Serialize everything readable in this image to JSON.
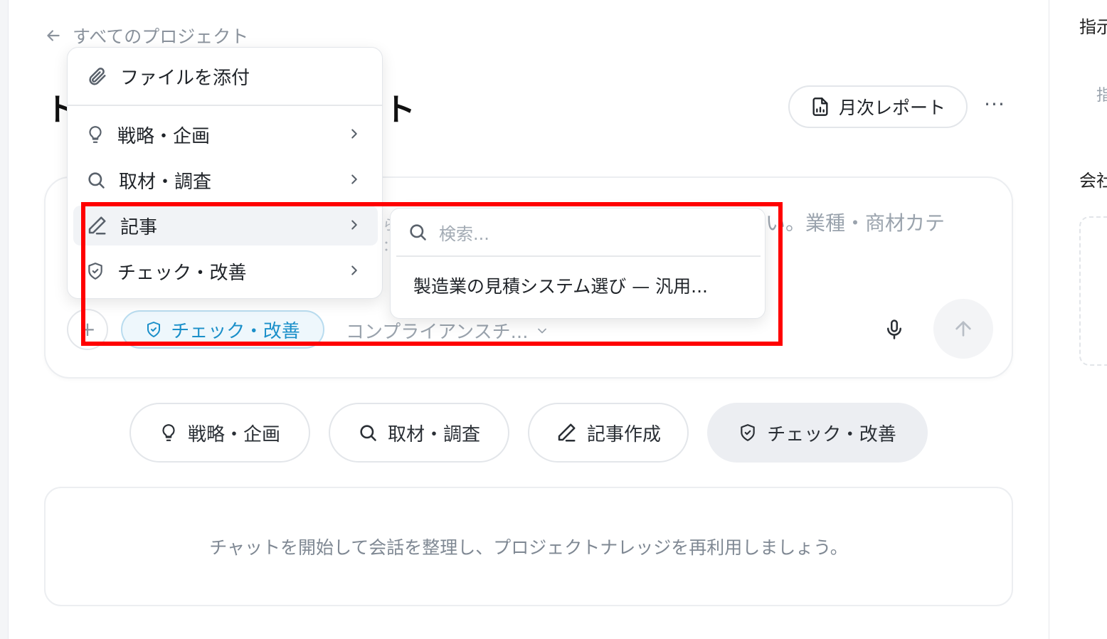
{
  "nav": {
    "back_label": "すべてのプロジェクト"
  },
  "header": {
    "title_start": "ト",
    "title_end": "ト",
    "report_button": "月次レポート",
    "more_label": "···"
  },
  "composer": {
    "placeholder_tail": "い。業種・商材カテ",
    "active_mode": "チェック・改善",
    "selected_item": "コンプライアンスチ...",
    "plus_label": "+"
  },
  "attach_menu": {
    "attach_label": "ファイルを添付",
    "items": [
      {
        "label": "戦略・企画",
        "icon": "lightbulb-icon"
      },
      {
        "label": "取材・調査",
        "icon": "search-icon"
      },
      {
        "label": "記事",
        "icon": "pencil-icon"
      },
      {
        "label": "チェック・改善",
        "icon": "shield-check-icon"
      }
    ]
  },
  "submenu": {
    "search_placeholder": "検索...",
    "items": [
      "製造業の見積システム選び — 汎用..."
    ]
  },
  "quick_actions": [
    {
      "label": "戦略・企画",
      "icon": "lightbulb-icon"
    },
    {
      "label": "取材・調査",
      "icon": "search-icon"
    },
    {
      "label": "記事作成",
      "icon": "pencil-icon"
    },
    {
      "label": "チェック・改善",
      "icon": "shield-check-icon"
    }
  ],
  "empty_state": "チャットを開始して会話を整理し、プロジェクトナレッジを再利用しましょう。",
  "right_panel": {
    "title_fragment": "指示",
    "item_fragment": "指",
    "section_fragment": "会社"
  },
  "colors": {
    "accent": "#1a8fc9",
    "highlight": "#ff0000"
  }
}
